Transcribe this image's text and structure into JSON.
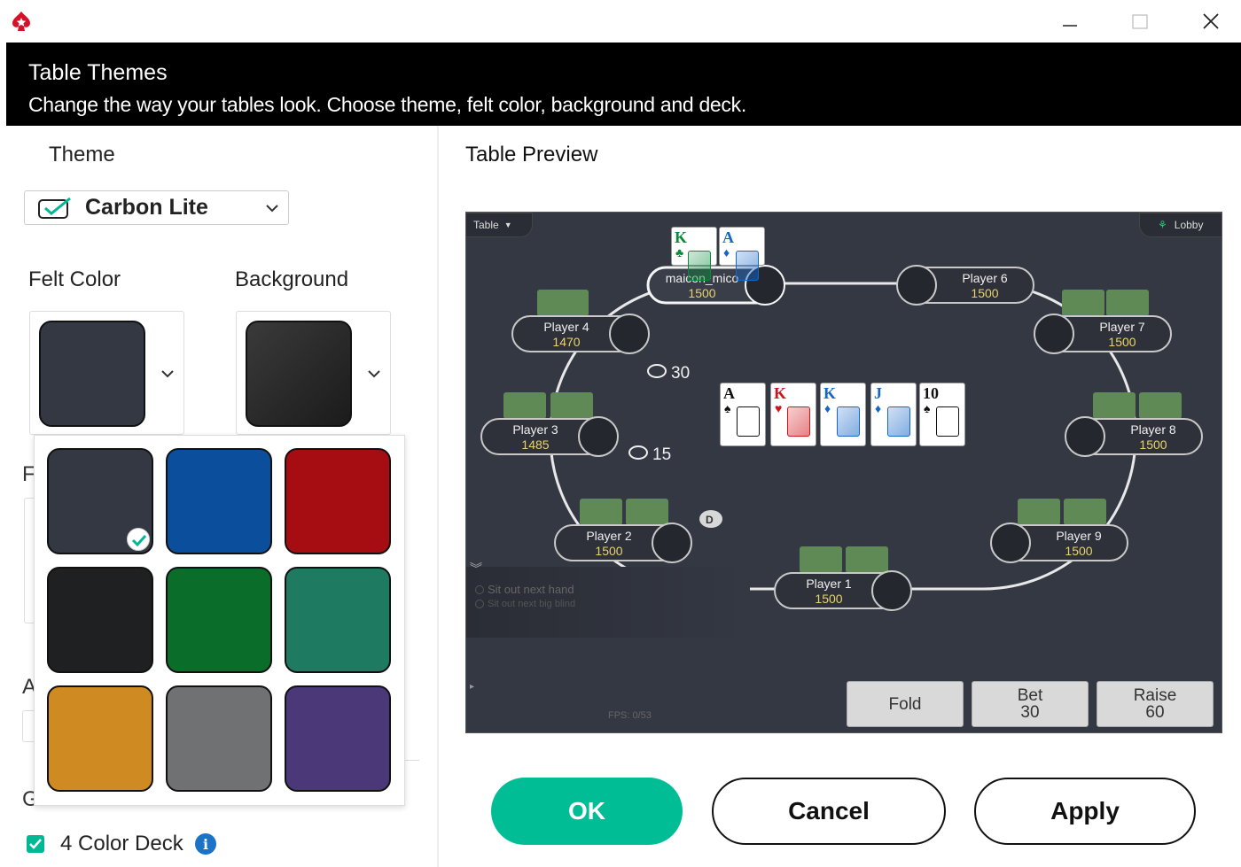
{
  "window": {
    "minimize_icon": "minimize-icon",
    "maximize_icon": "maximize-icon",
    "close_icon": "close-icon"
  },
  "header": {
    "title": "Table Themes",
    "subtitle": "Change the way your tables look. Choose theme, felt color, background and deck."
  },
  "left": {
    "theme_label": "Theme",
    "theme_value": "Carbon Lite",
    "felt_label": "Felt Color",
    "background_label": "Background",
    "felt_current": "#343843",
    "background_current": "#2b2b2b",
    "partial_f": "F",
    "partial_a": "A",
    "partial_g": "G",
    "four_color_label": "4 Color Deck",
    "four_color_checked": true,
    "info_glyph": "i"
  },
  "felt_options": [
    {
      "color": "#343843",
      "selected": true
    },
    {
      "color": "#0b4f9c",
      "selected": false
    },
    {
      "color": "#a60d12",
      "selected": false
    },
    {
      "color": "#1f2021",
      "selected": false
    },
    {
      "color": "#0a6e2a",
      "selected": false
    },
    {
      "color": "#1e7a60",
      "selected": false
    },
    {
      "color": "#d08a22",
      "selected": false
    },
    {
      "color": "#6f7173",
      "selected": false
    },
    {
      "color": "#4a3878",
      "selected": false
    }
  ],
  "preview": {
    "title": "Table Preview",
    "table_tab": "Table",
    "lobby_tab": "Lobby",
    "pot_main": "30",
    "pot_side": "15",
    "dealer": "D",
    "sit_out_next_hand": "Sit out next hand",
    "sit_out_big_blind": "Sit out next big blind",
    "fps": "FPS: 0/53",
    "board": [
      {
        "rank": "A",
        "suit": "♠",
        "color": "#111"
      },
      {
        "rank": "K",
        "suit": "♥",
        "color": "#d1141a"
      },
      {
        "rank": "K",
        "suit": "♦",
        "color": "#1666c8"
      },
      {
        "rank": "J",
        "suit": "♦",
        "color": "#1666c8"
      },
      {
        "rank": "10",
        "suit": "♠",
        "color": "#111"
      }
    ],
    "hole_cards": [
      {
        "rank": "K",
        "suit": "♣",
        "color": "#0a8a3a"
      },
      {
        "rank": "A",
        "suit": "♦",
        "color": "#1666c8"
      }
    ],
    "players": [
      {
        "name": "maicon_mico",
        "stack": "1500"
      },
      {
        "name": "Player 6",
        "stack": "1500"
      },
      {
        "name": "Player 4",
        "stack": "1470"
      },
      {
        "name": "Player 7",
        "stack": "1500"
      },
      {
        "name": "Player 3",
        "stack": "1485"
      },
      {
        "name": "Player 8",
        "stack": "1500"
      },
      {
        "name": "Player 2",
        "stack": "1500"
      },
      {
        "name": "Player 9",
        "stack": "1500"
      },
      {
        "name": "Player 1",
        "stack": "1500"
      }
    ],
    "actions": {
      "fold": "Fold",
      "bet_label": "Bet",
      "bet_value": "30",
      "raise_label": "Raise",
      "raise_value": "60"
    }
  },
  "buttons": {
    "ok": "OK",
    "cancel": "Cancel",
    "apply": "Apply"
  }
}
